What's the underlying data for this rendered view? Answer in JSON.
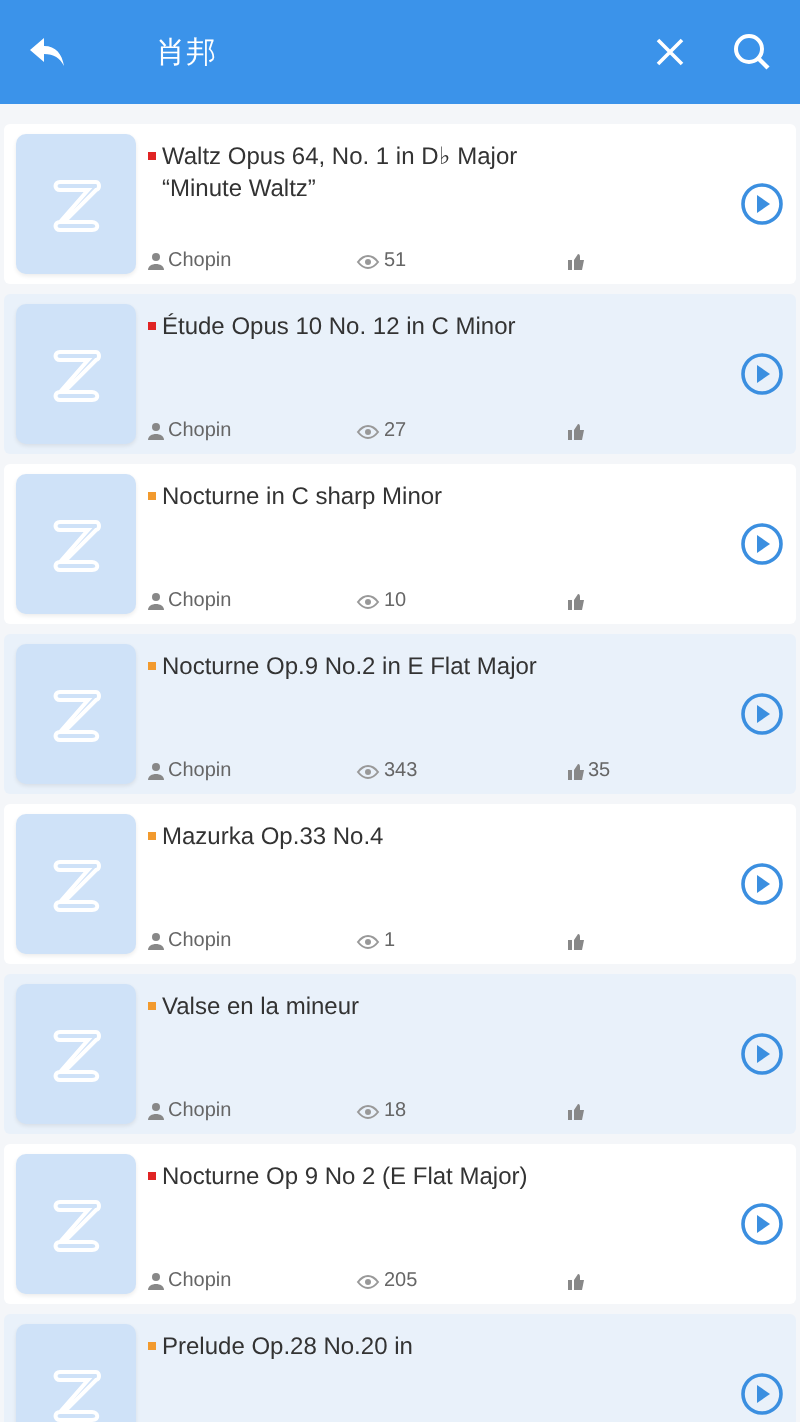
{
  "header": {
    "title": "肖邦"
  },
  "pieces": [
    {
      "title": "Waltz Opus 64, No. 1 in D♭ Major “Minute Waltz”",
      "color": "#e02424",
      "author": "Chopin",
      "views": "51"
    },
    {
      "title": "Étude Opus 10 No. 12 in C Minor",
      "color": "#e02424",
      "author": "Chopin",
      "views": "27"
    },
    {
      "title": "Nocturne in C sharp Minor",
      "color": "#f29a2e",
      "author": "Chopin",
      "views": "10"
    },
    {
      "title": "Nocturne Op.9 No.2 in E Flat Major",
      "color": "#f29a2e",
      "author": "Chopin",
      "views": "343",
      "likes": "35"
    },
    {
      "title": "Mazurka Op.33 No.4",
      "color": "#f29a2e",
      "author": "Chopin",
      "views": "1"
    },
    {
      "title": "Valse en la mineur",
      "color": "#f29a2e",
      "author": "Chopin",
      "views": "18"
    },
    {
      "title": "Nocturne Op 9 No 2 (E Flat Major)",
      "color": "#e02424",
      "author": "Chopin",
      "views": "205"
    },
    {
      "title": "Prelude Op.28 No.20 in",
      "color": "#f29a2e"
    }
  ]
}
